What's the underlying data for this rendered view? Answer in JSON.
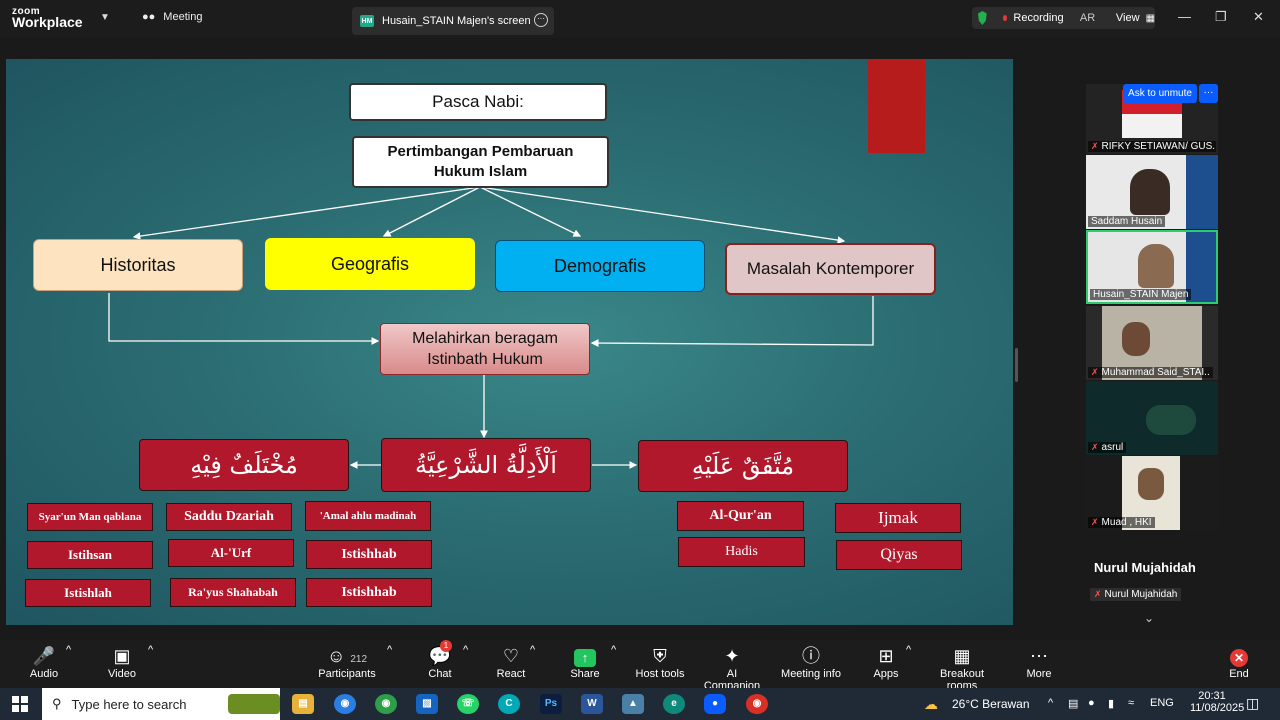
{
  "app": {
    "logo_line1": "zoom",
    "logo_line2": "Workplace",
    "meeting_tab": "Meeting",
    "share_tab_initials": "HM",
    "share_tab_label": "Husain_STAIN Majen's screen",
    "recording_label": "Recording",
    "user_initials": "AR",
    "view_label": "View"
  },
  "slide": {
    "title": "Pasca Nabi:",
    "subtitle": "Pertimbangan Pembaruan Hukum Islam",
    "categories": [
      {
        "label": "Historitas",
        "color": "#fde3c0"
      },
      {
        "label": "Geografis",
        "color": "#ffff00"
      },
      {
        "label": "Demografis",
        "color": "#00b0f0"
      },
      {
        "label": "Masalah Kontemporer",
        "color": "#e0c6c6"
      }
    ],
    "center": "Melahirkan beragam Istinbath Hukum",
    "arabic_left": "مُخْتَلَفٌ فِيْهِ",
    "arabic_mid": "اَلْأَدِلَّةُ الشَّرْعِيَّةُ",
    "arabic_right": "مُتَّفَقٌ عَلَيْهِ",
    "left_items": [
      "Syar'un Man qablana",
      "Saddu Dzariah",
      "'Amal ahlu madinah",
      "Istihsan",
      "Al-'Urf",
      "Istishhab",
      "Istishlah",
      "Ra'yus Shahabah",
      "Istishhab"
    ],
    "right_items": [
      "Al-Qur'an",
      "Ijmak",
      "Hadis",
      "Qiyas"
    ]
  },
  "participants_panel": {
    "ask_unmute": "Ask to unmute",
    "more": "···",
    "tiles": [
      {
        "name": "RIFKY SETIAWAN/ GUS..",
        "muted": true
      },
      {
        "name": "Saddam Husain",
        "muted": false
      },
      {
        "name": "Husain_STAIN Majen",
        "muted": false
      },
      {
        "name": "Muhammad Said_STAI..",
        "muted": true
      },
      {
        "name": "asrul",
        "muted": true
      },
      {
        "name": "Muad , HKI",
        "muted": true
      }
    ],
    "solo_name": "Nurul Mujahidah",
    "solo_label": "Nurul Mujahidah"
  },
  "toolbar": {
    "audio": "Audio",
    "video": "Video",
    "participants": "Participants",
    "participants_count": "212",
    "chat": "Chat",
    "chat_badge": "1",
    "react": "React",
    "share": "Share",
    "host_tools": "Host tools",
    "ai_companion": "AI Companion",
    "meeting_info": "Meeting info",
    "apps": "Apps",
    "breakout": "Breakout rooms",
    "more": "More",
    "end": "End"
  },
  "taskbar": {
    "search_placeholder": "Type here to search",
    "weather": "26°C  Berawan",
    "lang": "ENG",
    "time": "20:31",
    "date": "11/08/2025"
  }
}
